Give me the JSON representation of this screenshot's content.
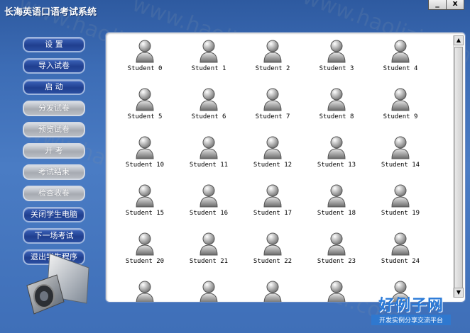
{
  "window": {
    "title": "长海英语口语考试系统",
    "minimize": "_",
    "close": "x"
  },
  "sidebar": {
    "items": [
      {
        "label": "设    置",
        "enabled": true
      },
      {
        "label": "导入试卷",
        "enabled": true
      },
      {
        "label": "启    动",
        "enabled": true
      },
      {
        "label": "分发试卷",
        "enabled": false
      },
      {
        "label": "预览试卷",
        "enabled": false
      },
      {
        "label": "开    考",
        "enabled": false
      },
      {
        "label": "考试结束",
        "enabled": false
      },
      {
        "label": "检查收卷",
        "enabled": false
      },
      {
        "label": "关闭学生电脑",
        "enabled": true
      },
      {
        "label": "下一场考试",
        "enabled": true
      },
      {
        "label": "退出学生程序",
        "enabled": true
      }
    ]
  },
  "students": [
    "Student 0",
    "Student 1",
    "Student 2",
    "Student 3",
    "Student 4",
    "Student 5",
    "Student 6",
    "Student 7",
    "Student 8",
    "Student 9",
    "Student 10",
    "Student 11",
    "Student 12",
    "Student 13",
    "Student 14",
    "Student 15",
    "Student 16",
    "Student 17",
    "Student 18",
    "Student 19",
    "Student 20",
    "Student 21",
    "Student 22",
    "Student 23",
    "Student 24",
    "",
    "",
    "",
    "",
    ""
  ],
  "scrollbar": {
    "up": "▲",
    "down": "▼"
  },
  "watermark": "www.haolizi.com",
  "brand": {
    "title": "好例子网",
    "subtitle": "开发实例分享交流平台"
  }
}
